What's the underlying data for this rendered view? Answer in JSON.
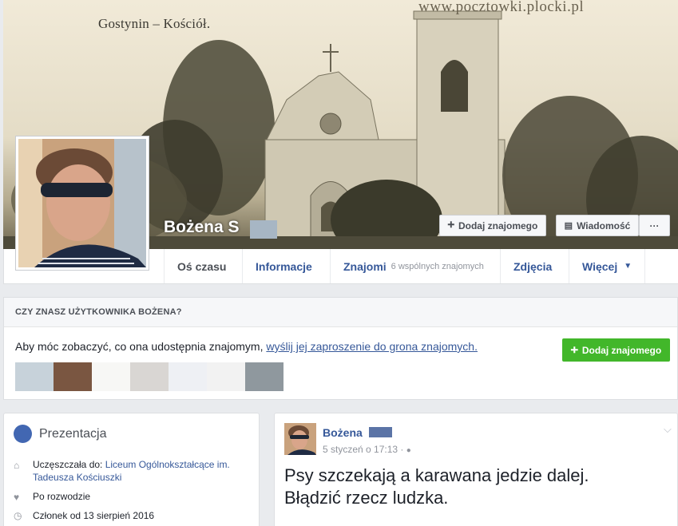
{
  "cover": {
    "caption_left": "Gostynin – Kościół.",
    "caption_right": "www.pocztowki.plocki.pl"
  },
  "profile": {
    "name": "Bożena S",
    "add_friend": "Dodaj znajomego",
    "message": "Wiadomość",
    "more": "···"
  },
  "tabs": [
    {
      "label": "Oś czasu"
    },
    {
      "label": "Informacje"
    },
    {
      "label": "Znajomi",
      "sub": "6 wspólnych znajomych"
    },
    {
      "label": "Zdjęcia"
    },
    {
      "label": "Więcej"
    }
  ],
  "know": {
    "header": "CZY ZNASZ UŻYTKOWNIKA BOŻENA?",
    "text": "Aby móc zobaczyć, co ona udostępnia znajomym, ",
    "link": "wyślij jej zaproszenie do grona znajomych.",
    "button": "Dodaj znajomego",
    "swatch_colors": [
      "#c7d2da",
      "#7a5641",
      "#f7f7f5",
      "#d9d6d3",
      "#eef0f4",
      "#f2f2f2",
      "#8f989e"
    ]
  },
  "intro": {
    "title": "Prezentacja",
    "school_prefix": "Uczęszczała do: ",
    "school_link_1": "Liceum Ogólnokształcące im.",
    "school_link_2": "Tadeusza Kościuszki",
    "status": "Po rozwodzie",
    "member": "Członek od 13 sierpień 2016"
  },
  "post": {
    "author": "Bożena",
    "time": "5 styczeń o 17:13 ·",
    "line1": "Psy szczekają a karawana jedzie dalej.",
    "line2": "Błądzić rzecz ludzka."
  },
  "colors": {
    "link": "#365899",
    "green": "#42b72a",
    "brand": "#4267b2"
  }
}
